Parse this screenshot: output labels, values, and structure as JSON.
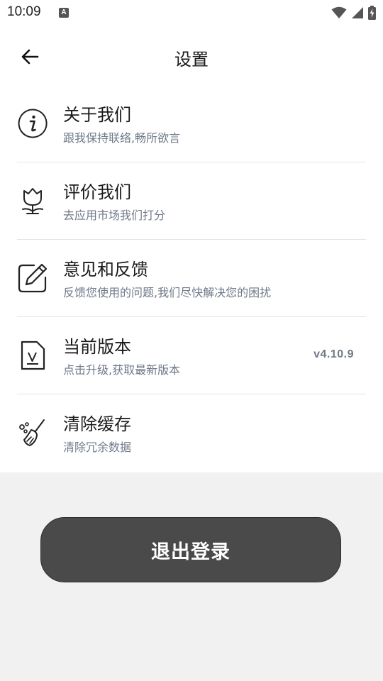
{
  "status_bar": {
    "time": "10:09",
    "notification_icon_letter": "A",
    "icons": [
      "wifi-icon",
      "cell-signal-icon",
      "battery-charging-icon"
    ]
  },
  "header": {
    "title": "设置",
    "back_icon": "arrow-left-icon"
  },
  "settings": [
    {
      "title": "关于我们",
      "subtitle": "跟我保持联络,畅所欲言",
      "icon": "info-circle-icon"
    },
    {
      "title": "评价我们",
      "subtitle": "去应用市场我们打分",
      "icon": "tulip-icon"
    },
    {
      "title": "意见和反馈",
      "subtitle": "反馈您使用的问题,我们尽快解决您的困扰",
      "icon": "edit-square-icon"
    },
    {
      "title": "当前版本",
      "subtitle": "点击升级,获取最新版本",
      "icon": "version-document-icon",
      "value": "v4.10.9"
    },
    {
      "title": "清除缓存",
      "subtitle": "清除冗余数据",
      "icon": "broom-icon"
    }
  ],
  "logout": {
    "label": "退出登录"
  },
  "colors": {
    "background": "#f1f1f1",
    "card": "#ffffff",
    "logout_button": "#4a4a4a",
    "subtitle_text": "#6f7a8a"
  }
}
